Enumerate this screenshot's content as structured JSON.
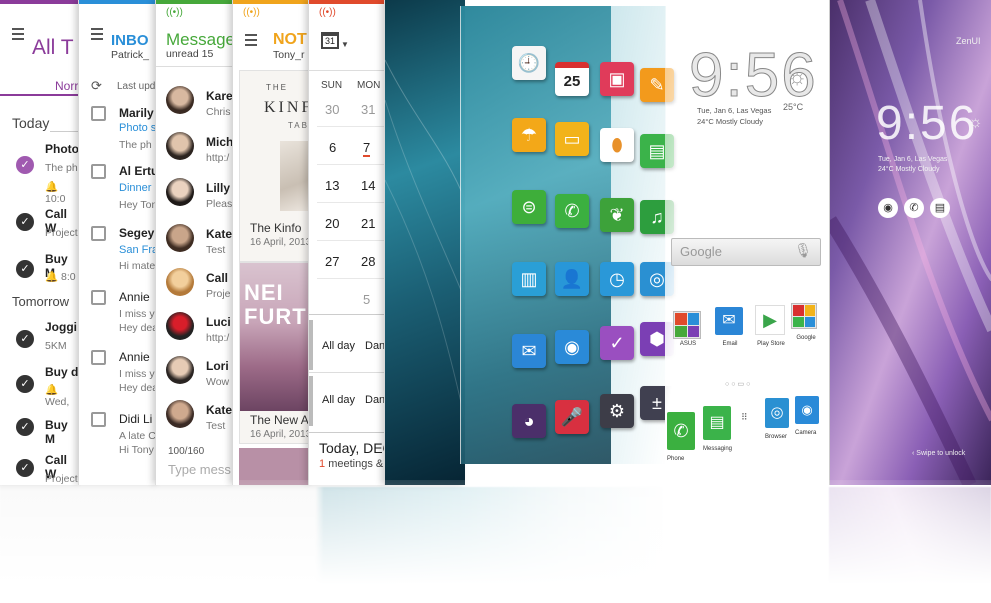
{
  "todo": {
    "title": "All T",
    "tab": "Norr",
    "section_today": "Today",
    "section_tomorrow": "Tomorrow",
    "items": [
      {
        "title": "Photo",
        "sub": "The ph",
        "extra": "10:0"
      },
      {
        "title": "Call W",
        "sub": "Project"
      },
      {
        "title": "Buy M",
        "sub": "8:0"
      },
      {
        "title": "Joggi",
        "sub": "5KM"
      },
      {
        "title": "Buy d",
        "sub": "Wed,"
      },
      {
        "title": "Buy M",
        "sub": ""
      },
      {
        "title": "Call W",
        "sub": "Project"
      }
    ]
  },
  "inbox": {
    "title": "INBO",
    "account": "Patrick_",
    "updated": "Last upd",
    "items": [
      {
        "from": "Marily",
        "subject": "Photo s",
        "preview": "The ph"
      },
      {
        "from": "Al Ertu",
        "subject": "Dinner",
        "preview": "Hey Ton"
      },
      {
        "from": "Segey",
        "subject": "San Fra",
        "preview": "Hi mate"
      },
      {
        "from": "Annie",
        "subject": "",
        "preview": "I miss y",
        "preview2": "Hey dea"
      },
      {
        "from": "Annie",
        "subject": "",
        "preview": "I miss y",
        "preview2": "Hey dea"
      },
      {
        "from": "Didi Li",
        "subject": "",
        "preview": "A late C",
        "preview2": "Hi Tony"
      }
    ]
  },
  "messages": {
    "title": "Message",
    "unread": "unread 15",
    "items": [
      {
        "name": "Kare",
        "preview": "Chris"
      },
      {
        "name": "Mich",
        "preview": "http:/"
      },
      {
        "name": "Lilly",
        "preview": "Pleas"
      },
      {
        "name": "Kate",
        "preview": "Test"
      },
      {
        "name": "Call",
        "preview": "Proje"
      },
      {
        "name": "Luci",
        "preview": "http:/"
      },
      {
        "name": "Lori",
        "preview": "Wow"
      },
      {
        "name": "Kate",
        "preview": "Test"
      }
    ],
    "counter": "100/160",
    "input_placeholder": "Type mess"
  },
  "notes": {
    "title": "NOT",
    "account": "Tony_r",
    "cover_word": "KINF",
    "cover_small": "THE",
    "cover_small2": "TAB",
    "note1_title": "The Kinfo",
    "note1_date": "16 April, 2013",
    "poster_text": "NEI FURT",
    "note2_title": "The New A",
    "note2_date": "16 April, 2013"
  },
  "calendar": {
    "date_icon": "31",
    "days": [
      "SUN",
      "MON"
    ],
    "rows": [
      [
        "30",
        "31"
      ],
      [
        "6",
        "7"
      ],
      [
        "13",
        "14"
      ],
      [
        "20",
        "21"
      ],
      [
        "27",
        "28"
      ],
      [
        "",
        "5"
      ]
    ],
    "allday1": "All day",
    "allday1_event": "Dan",
    "allday2": "All day",
    "allday2_event": "Dan",
    "footer_title": "Today, DEC",
    "footer_count": "1",
    "footer_text": "meetings &"
  },
  "home": {
    "clock": "9:56",
    "date_line": "Tue, Jan 6, Las Vegas",
    "weather_line": "24°C Mostly Cloudy",
    "temp": "25°C",
    "search_placeholder": "Google",
    "calendar_tile": "25",
    "folders": [
      {
        "label": "ASUS"
      },
      {
        "label": "Email"
      },
      {
        "label": "Play Store"
      },
      {
        "label": "Google"
      }
    ],
    "dock": [
      {
        "label": "Phone"
      },
      {
        "label": "Messaging"
      },
      {
        "label": "Browser"
      },
      {
        "label": "Camera"
      }
    ]
  },
  "lock": {
    "brand": "ZenUI",
    "clock": "9:56",
    "date_line": "Tue, Jan 6, Las Vegas",
    "weather_line": "24°C Mostly Cloudy",
    "unlock_hint": "Swipe to unlock"
  },
  "colors": {
    "todo_accent": "#8b3b9a",
    "inbox_accent": "#2a8fd8",
    "message_accent": "#46a83a",
    "notes_accent": "#f0a41c",
    "calendar_accent": "#e04a2c"
  }
}
